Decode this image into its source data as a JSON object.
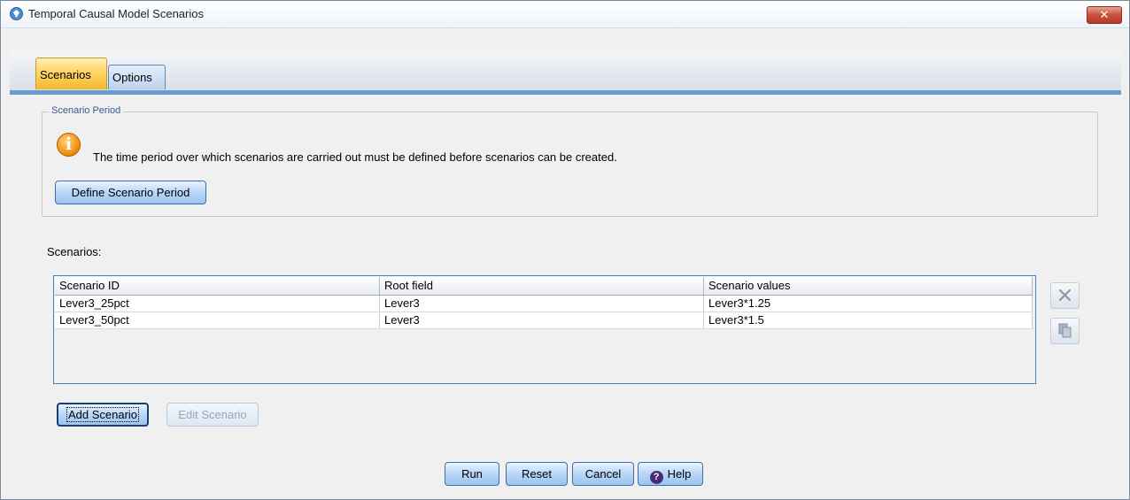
{
  "window": {
    "title": "Temporal Causal Model Scenarios",
    "close_glyph": "✕"
  },
  "tabs": [
    {
      "label": "Scenarios",
      "active": true
    },
    {
      "label": "Options",
      "active": false
    }
  ],
  "scenario_period": {
    "legend": "Scenario Period",
    "info_icon": "info-icon",
    "message": "The time period over which scenarios are carried out must be defined before scenarios can be created.",
    "define_button": "Define Scenario Period"
  },
  "scenarios": {
    "label": "Scenarios:",
    "columns": [
      "Scenario ID",
      "Root field",
      "Scenario values"
    ],
    "rows": [
      [
        "Lever3_25pct",
        "Lever3",
        "Lever3*1.25"
      ],
      [
        "Lever3_50pct",
        "Lever3",
        "Lever3*1.5"
      ]
    ],
    "side_buttons": [
      "delete-icon",
      "copy-icon"
    ],
    "add_button": "Add Scenario",
    "edit_button": "Edit Scenario"
  },
  "footer": {
    "run": "Run",
    "reset": "Reset",
    "cancel": "Cancel",
    "help": "Help"
  },
  "colors": {
    "active_tab": "#f4b92f",
    "button": "#9cc5f0",
    "close": "#c9503a",
    "table_border": "#4a7fbe"
  }
}
